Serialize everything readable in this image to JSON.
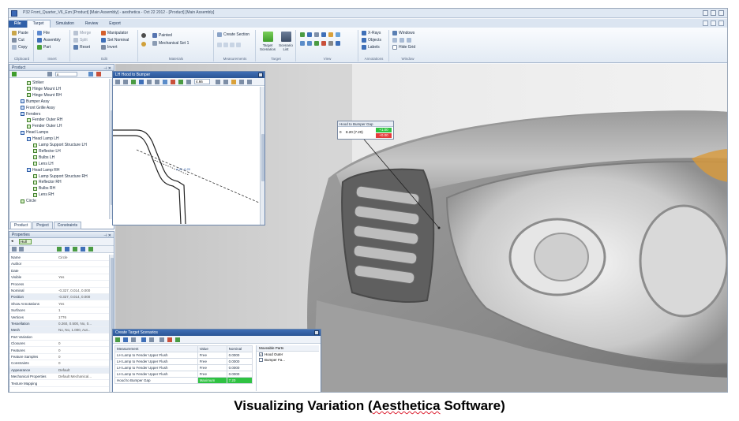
{
  "window": {
    "title": "P32 Front_Quarter_V6_Ezn [Product] [Main Assembly] - aesthetica - Oct 22 2012 - [Product] [Main Assembly]"
  },
  "ribbon_tabs": [
    "File",
    "Target",
    "Simulation",
    "Review",
    "Export"
  ],
  "active_ribbon_tab": "Target",
  "ribbon": {
    "clipboard": {
      "label": "Clipboard",
      "paste": "Paste",
      "cut": "Cut",
      "copy": "Copy"
    },
    "insert": {
      "label": "Insert",
      "file": "File",
      "assembly": "Assembly",
      "part": "Part"
    },
    "edit": {
      "label": "Edit",
      "merge": "Merge",
      "split": "Split",
      "manipulator": "Manipulator",
      "set_nominal": "Set Nominal",
      "reset": "Reset",
      "invert": "Invert"
    },
    "materials": {
      "label": "Materials",
      "painted": "Painted",
      "mechanical_set": "Mechanical Set 1"
    },
    "measurements": {
      "label": "Measurements",
      "create_section": "Create Section"
    },
    "target": {
      "label": "Target",
      "target_scenarios": "Target Scenarios",
      "scenario_list": "Scenario List"
    },
    "view": {
      "label": "View"
    },
    "annotations": {
      "label": "Annotations",
      "x_rays": "X-Rays",
      "objects": "Objects",
      "labels": "Labels"
    },
    "window": {
      "label": "Window",
      "windows": "Windows",
      "hide_grid": "Hide Grid"
    }
  },
  "product_panel": {
    "title": "Product",
    "zoom": "0",
    "tree": [
      {
        "label": "Striker",
        "level": 2,
        "kind": "part"
      },
      {
        "label": "Hinge Mount LH",
        "level": 2,
        "kind": "part"
      },
      {
        "label": "Hinge Mount RH",
        "level": 2,
        "kind": "part"
      },
      {
        "label": "Bumper Assy",
        "level": 1,
        "kind": "asm"
      },
      {
        "label": "Front Grille Assy",
        "level": 1,
        "kind": "asm"
      },
      {
        "label": "Fenders",
        "level": 1,
        "kind": "asm"
      },
      {
        "label": "Fender Outer RH",
        "level": 2,
        "kind": "part"
      },
      {
        "label": "Fender Outer LH",
        "level": 2,
        "kind": "part"
      },
      {
        "label": "Head Lamps",
        "level": 1,
        "kind": "asm"
      },
      {
        "label": "Head Lamp LH",
        "level": 2,
        "kind": "asm"
      },
      {
        "label": "Lamp Support Structure LH",
        "level": 3,
        "kind": "part"
      },
      {
        "label": "Reflector LH",
        "level": 3,
        "kind": "part"
      },
      {
        "label": "Bulbs LH",
        "level": 3,
        "kind": "part"
      },
      {
        "label": "Lens LH",
        "level": 3,
        "kind": "part"
      },
      {
        "label": "Head Lamp RH",
        "level": 2,
        "kind": "asm"
      },
      {
        "label": "Lamp Support Structure RH",
        "level": 3,
        "kind": "part"
      },
      {
        "label": "Reflector RH",
        "level": 3,
        "kind": "part"
      },
      {
        "label": "Bulbs RH",
        "level": 3,
        "kind": "part"
      },
      {
        "label": "Lens RH",
        "level": 3,
        "kind": "part"
      },
      {
        "label": "Circle",
        "level": 1,
        "kind": "part"
      }
    ],
    "tabs": [
      "Product",
      "Project",
      "Constraints"
    ]
  },
  "properties_panel": {
    "title": "Properties",
    "selected": "Hull",
    "rows": [
      {
        "k": "Name",
        "v": "Circle"
      },
      {
        "k": "Author",
        "v": ""
      },
      {
        "k": "Date",
        "v": ""
      },
      {
        "k": "Visible",
        "v": "Yes"
      },
      {
        "k": "Process",
        "v": ""
      },
      {
        "k": "Nominal",
        "v": "-0.327, 0.014, 0.000"
      },
      {
        "k": "Position",
        "v": "-0.327, 0.014, 0.000"
      },
      {
        "k": "Show Annotations",
        "v": "Yes"
      },
      {
        "k": "Surfaces",
        "v": "1"
      },
      {
        "k": "Vertices",
        "v": "1776"
      },
      {
        "k": "Tessellation",
        "v": "0.260, 0.500, No, 0..."
      },
      {
        "k": "Mesh",
        "v": "No, No, 1.000, Aut..."
      },
      {
        "k": "Part Variation",
        "v": ""
      },
      {
        "k": "Closures",
        "v": "0"
      },
      {
        "k": "Features",
        "v": "0"
      },
      {
        "k": "Feature Samples",
        "v": "0"
      },
      {
        "k": "Constraints",
        "v": "0"
      },
      {
        "k": "Appearance",
        "v": "Default"
      },
      {
        "k": "Mechanical Properties",
        "v": "Default Mechanical..."
      },
      {
        "k": "Texture Mapping",
        "v": ""
      }
    ]
  },
  "section_view": {
    "title": "LH Hood to Bumper",
    "zoom": "4.66",
    "label": "a.20  -0.20"
  },
  "hood_gap_popup": {
    "title": "Hood to Bumper Gap",
    "row_label": "0",
    "value": "8.20 (7.20)",
    "upper": "+1.00",
    "lower": "+0.00"
  },
  "target_scenarios": {
    "title": "Create Target Scenarios",
    "columns": [
      "Measurement",
      "Value",
      "Nominal"
    ],
    "rows": [
      {
        "measurement": "LH Lamp to Fender Upper Flush",
        "value": "Free",
        "nominal": "0.0000",
        "highlight": false
      },
      {
        "measurement": "LH Lamp to Fender Upper Flush",
        "value": "Free",
        "nominal": "0.0000",
        "highlight": false
      },
      {
        "measurement": "LH Lamp to Fender Upper Flush",
        "value": "Free",
        "nominal": "0.0000",
        "highlight": false
      },
      {
        "measurement": "LH Lamp to Fender Upper Flush",
        "value": "Free",
        "nominal": "0.0000",
        "highlight": false
      },
      {
        "measurement": "Hood to Bumper Gap",
        "value": "Maximum",
        "nominal": "7.20",
        "highlight": true
      }
    ],
    "movable_header": "Moveable Parts",
    "movable": [
      {
        "label": "Hood Outer",
        "checked": true
      },
      {
        "label": "Bumper Fa...",
        "checked": false
      }
    ]
  },
  "caption": {
    "prefix": "Visualizing Variation (",
    "underlined": "Aesthetica",
    "suffix": " Software)"
  }
}
